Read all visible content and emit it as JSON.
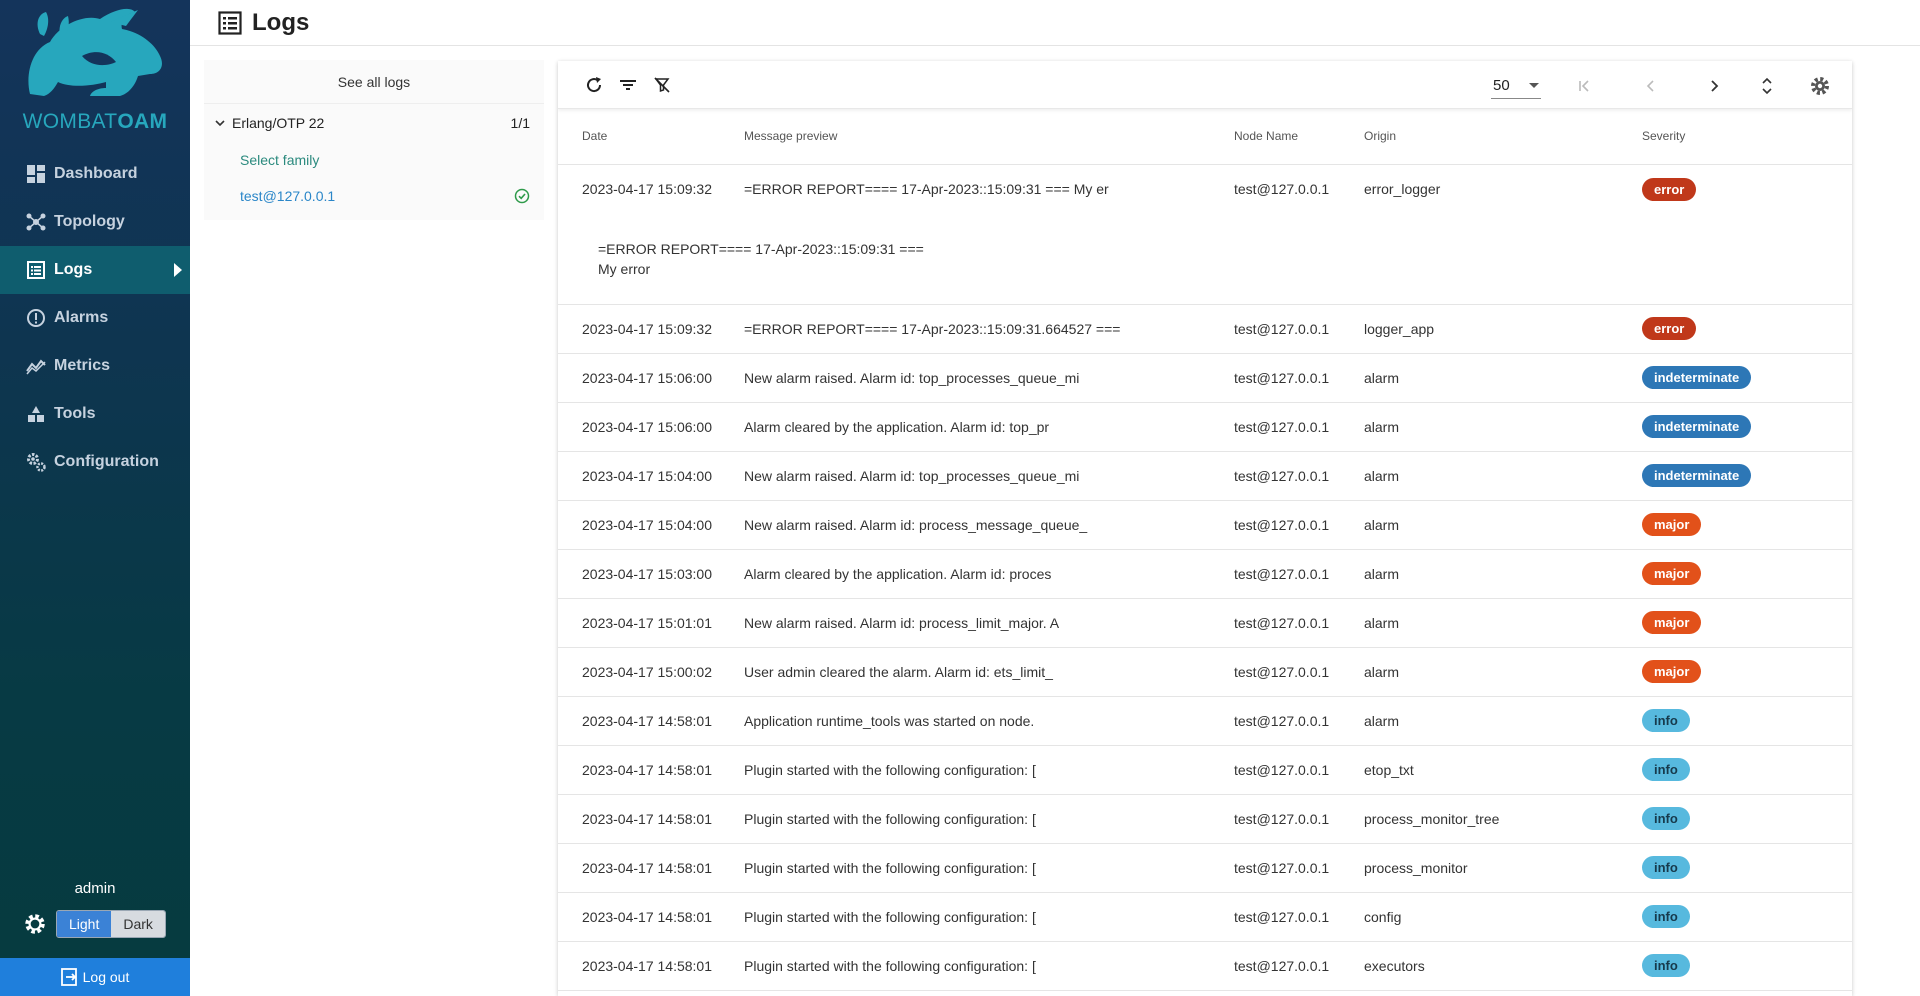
{
  "sidebar": {
    "brand_light": "WOMBAT",
    "brand_bold": "OAM",
    "items": [
      {
        "label": "Dashboard"
      },
      {
        "label": "Topology"
      },
      {
        "label": "Logs"
      },
      {
        "label": "Alarms"
      },
      {
        "label": "Metrics"
      },
      {
        "label": "Tools"
      },
      {
        "label": "Configuration"
      }
    ],
    "user": "admin",
    "theme_light": "Light",
    "theme_dark": "Dark",
    "logout": "Log out"
  },
  "header": {
    "title": "Logs"
  },
  "filter": {
    "see_all": "See all logs",
    "family_name": "Erlang/OTP 22",
    "family_count": "1/1",
    "select_family": "Select family",
    "node": "test@127.0.0.1"
  },
  "toolbar": {
    "per_page": "50"
  },
  "table": {
    "columns": [
      "Date",
      "Message preview",
      "Node Name",
      "Origin",
      "Severity"
    ],
    "expanded_line1": "=ERROR REPORT==== 17-Apr-2023::15:09:31 ===",
    "expanded_line2": "My error",
    "rows": [
      {
        "date": "2023-04-17 15:09:32",
        "msg": "=ERROR REPORT==== 17-Apr-2023::15:09:31 === My er",
        "node": "test@127.0.0.1",
        "origin": "error_logger",
        "severity": "error"
      },
      {
        "date": "2023-04-17 15:09:32",
        "msg": "=ERROR REPORT==== 17-Apr-2023::15:09:31.664527 ===",
        "node": "test@127.0.0.1",
        "origin": "logger_app",
        "severity": "error"
      },
      {
        "date": "2023-04-17 15:06:00",
        "msg": "New alarm raised. Alarm id: top_processes_queue_mi",
        "node": "test@127.0.0.1",
        "origin": "alarm",
        "severity": "indeterminate"
      },
      {
        "date": "2023-04-17 15:06:00",
        "msg": "Alarm cleared by the application. Alarm id: top_pr",
        "node": "test@127.0.0.1",
        "origin": "alarm",
        "severity": "indeterminate"
      },
      {
        "date": "2023-04-17 15:04:00",
        "msg": "New alarm raised. Alarm id: top_processes_queue_mi",
        "node": "test@127.0.0.1",
        "origin": "alarm",
        "severity": "indeterminate"
      },
      {
        "date": "2023-04-17 15:04:00",
        "msg": "New alarm raised. Alarm id: process_message_queue_",
        "node": "test@127.0.0.1",
        "origin": "alarm",
        "severity": "major"
      },
      {
        "date": "2023-04-17 15:03:00",
        "msg": "Alarm cleared by the application. Alarm id: proces",
        "node": "test@127.0.0.1",
        "origin": "alarm",
        "severity": "major"
      },
      {
        "date": "2023-04-17 15:01:01",
        "msg": "New alarm raised. Alarm id: process_limit_major. A",
        "node": "test@127.0.0.1",
        "origin": "alarm",
        "severity": "major"
      },
      {
        "date": "2023-04-17 15:00:02",
        "msg": "User admin cleared the alarm. Alarm id: ets_limit_",
        "node": "test@127.0.0.1",
        "origin": "alarm",
        "severity": "major"
      },
      {
        "date": "2023-04-17 14:58:01",
        "msg": "Application runtime_tools was started on node.",
        "node": "test@127.0.0.1",
        "origin": "alarm",
        "severity": "info"
      },
      {
        "date": "2023-04-17 14:58:01",
        "msg": "Plugin started with the following configuration: [",
        "node": "test@127.0.0.1",
        "origin": "etop_txt",
        "severity": "info"
      },
      {
        "date": "2023-04-17 14:58:01",
        "msg": "Plugin started with the following configuration: [",
        "node": "test@127.0.0.1",
        "origin": "process_monitor_tree",
        "severity": "info"
      },
      {
        "date": "2023-04-17 14:58:01",
        "msg": "Plugin started with the following configuration: [",
        "node": "test@127.0.0.1",
        "origin": "process_monitor",
        "severity": "info"
      },
      {
        "date": "2023-04-17 14:58:01",
        "msg": "Plugin started with the following configuration: [",
        "node": "test@127.0.0.1",
        "origin": "config",
        "severity": "info"
      },
      {
        "date": "2023-04-17 14:58:01",
        "msg": "Plugin started with the following configuration: [",
        "node": "test@127.0.0.1",
        "origin": "executors",
        "severity": "info"
      }
    ]
  },
  "colors": {
    "error": "#c0381a",
    "indeterminate": "#2d77b6",
    "major": "#e2511a",
    "info": "#57b9de",
    "accent": "#1f7fdc"
  }
}
